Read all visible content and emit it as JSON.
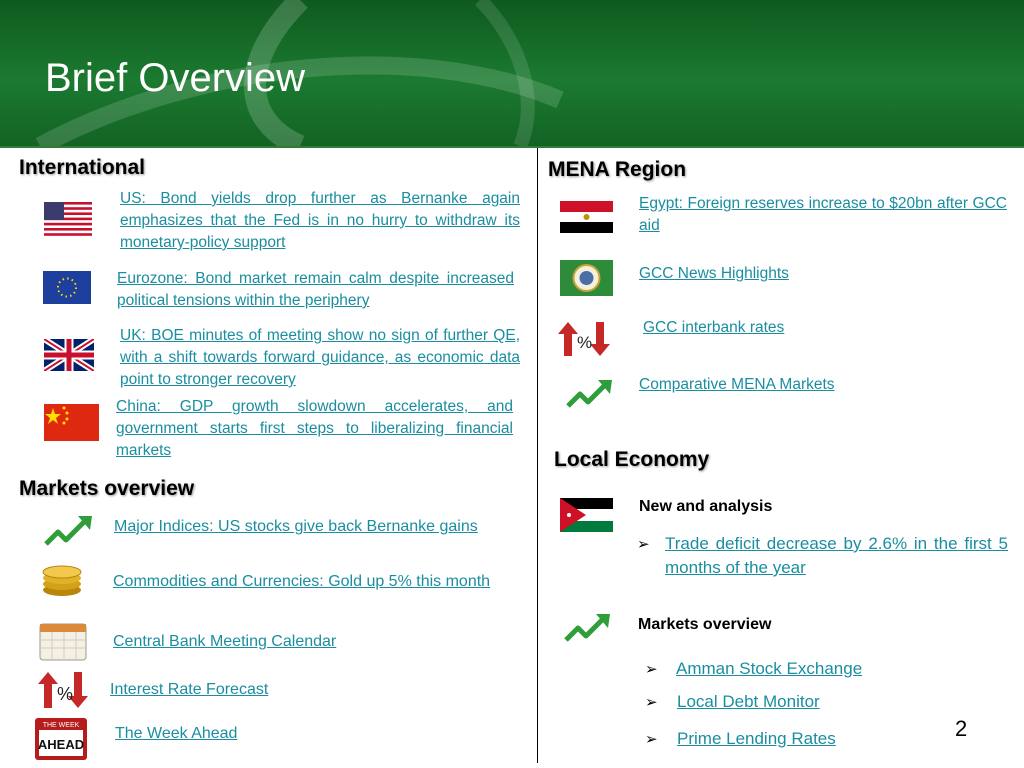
{
  "title": "Brief Overview",
  "page_number": "2",
  "international": {
    "heading": "International",
    "items": [
      {
        "text": "US: Bond yields drop further as Bernanke again emphasizes that the Fed is in no hurry to withdraw its monetary-policy support",
        "icon": "us-flag-icon"
      },
      {
        "text": "Eurozone: Bond market remain calm despite increased political tensions within the periphery",
        "icon": "eu-flag-icon"
      },
      {
        "text": "UK: BOE minutes of meeting show no sign of further QE, with a shift towards forward guidance, as economic data point to stronger recovery",
        "icon": "uk-flag-icon"
      },
      {
        "text": "China: GDP growth slowdown accelerates, and government starts first steps to liberalizing financial markets",
        "icon": "china-flag-icon"
      }
    ]
  },
  "markets_overview": {
    "heading": "Markets overview",
    "items": [
      {
        "text": "Major Indices: US stocks give back Bernanke gains",
        "icon": "trend-up-icon"
      },
      {
        "text": "Commodities and Currencies: Gold up 5% this month",
        "icon": "gold-coins-icon"
      },
      {
        "text": "Central Bank Meeting Calendar",
        "icon": "calendar-icon"
      },
      {
        "text": "Interest Rate Forecast",
        "icon": "rate-arrows-icon"
      },
      {
        "text": "The Week Ahead",
        "icon": "week-ahead-icon"
      }
    ]
  },
  "mena": {
    "heading": "MENA Region",
    "items": [
      {
        "text": "Egypt: Foreign reserves increase to $20bn after GCC aid",
        "icon": "egypt-flag-icon"
      },
      {
        "text": "GCC News Highlights",
        "icon": "gcc-flag-icon"
      },
      {
        "text": "GCC interbank rates",
        "icon": "rate-arrows-icon"
      },
      {
        "text": "Comparative MENA Markets",
        "icon": "trend-up-icon"
      }
    ]
  },
  "local_economy": {
    "heading": "Local Economy",
    "news_heading": "New and analysis",
    "news_items": [
      "Trade deficit decrease by 2.6% in the first 5 months of the year"
    ],
    "markets_heading": "Markets overview",
    "markets_items": [
      "Amman Stock Exchange",
      "Local Debt Monitor",
      "Prime Lending Rates"
    ]
  },
  "colors": {
    "header_green": "#1b7a30",
    "link": "#1a8ea0"
  }
}
